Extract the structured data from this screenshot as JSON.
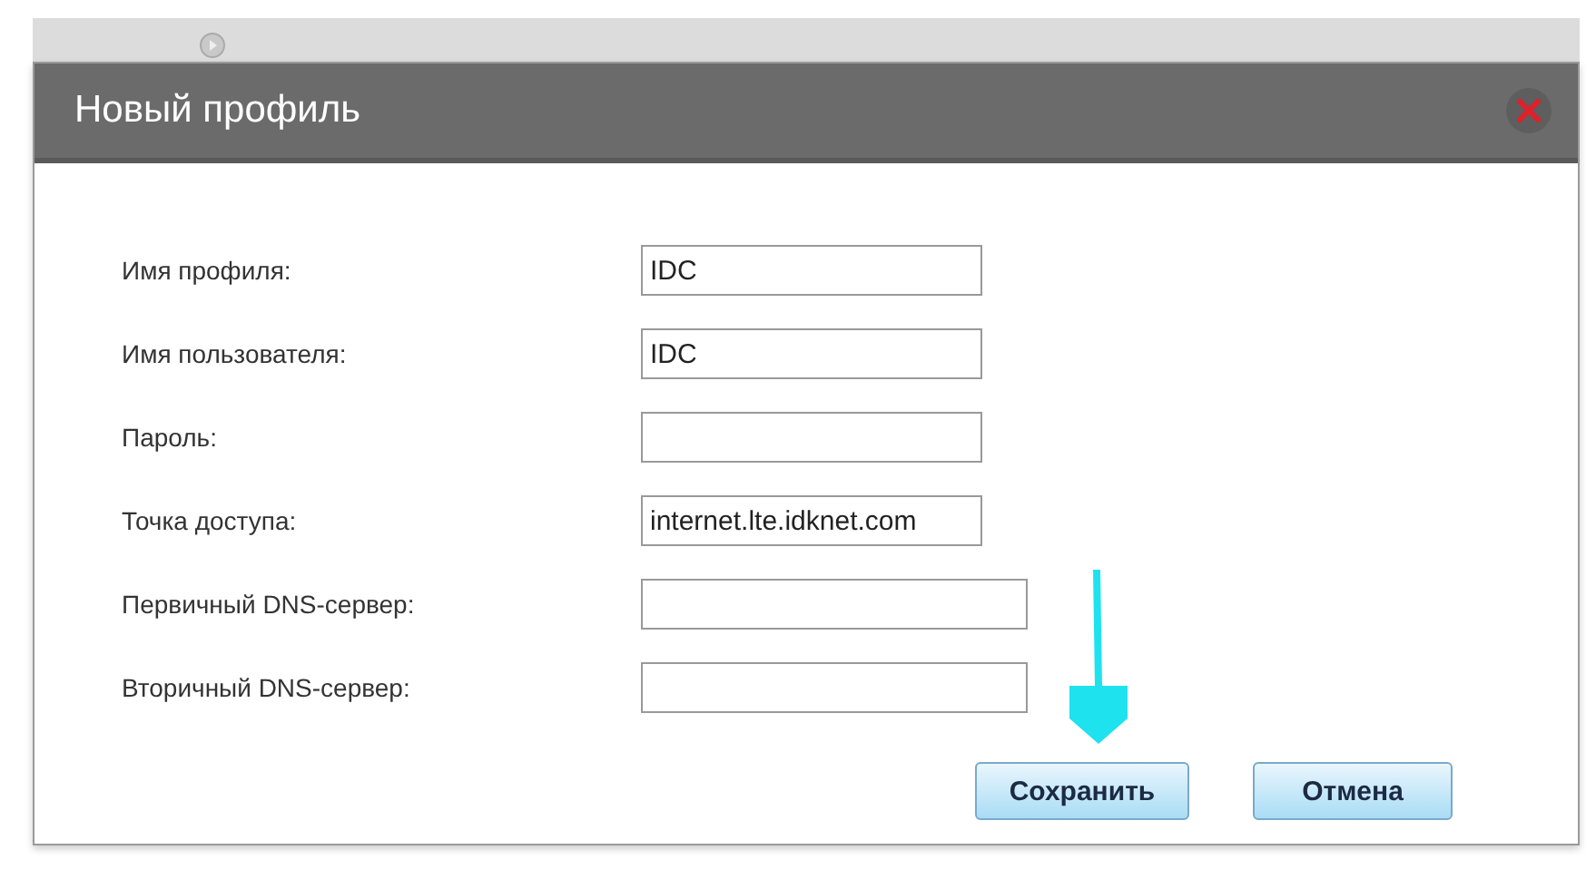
{
  "dialog": {
    "title": "Новый профиль"
  },
  "fields": [
    {
      "label": "Имя профиля:",
      "value": "IDC",
      "kind": "short"
    },
    {
      "label": "Имя пользователя:",
      "value": "IDC",
      "kind": "short"
    },
    {
      "label": "Пароль:",
      "kind": "short"
    },
    {
      "label": "Точка доступа:",
      "value": "internet.lte.idknet.com",
      "kind": "short"
    },
    {
      "label": "Первичный DNS-сервер:",
      "kind": "wide"
    },
    {
      "label": "Вторичный DNS-сервер:",
      "kind": "wide"
    }
  ],
  "buttons": [
    {
      "label": "Сохранить"
    },
    {
      "label": "Отмена"
    }
  ]
}
